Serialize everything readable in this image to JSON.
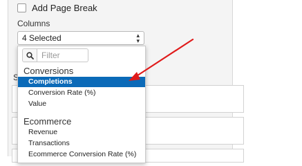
{
  "add_page_break": {
    "label": "Add Page Break",
    "checked": false
  },
  "columns": {
    "label": "Columns",
    "selected_text": "4 Selected",
    "filter_placeholder": "Filter",
    "groups": [
      {
        "title": "Conversions",
        "options": [
          {
            "label": "Completions",
            "highlighted": true
          },
          {
            "label": "Conversion Rate (%)",
            "highlighted": false
          },
          {
            "label": "Value",
            "highlighted": false
          }
        ]
      },
      {
        "title": "Ecommerce",
        "options": [
          {
            "label": "Revenue",
            "highlighted": false
          },
          {
            "label": "Transactions",
            "highlighted": false
          },
          {
            "label": "Ecommerce Conversion Rate (%)",
            "highlighted": false
          }
        ]
      }
    ]
  },
  "partial_label": "S",
  "colors": {
    "selected_bg": "#0b6ab8",
    "arrow": "#e01b1b",
    "panel_bg": "#f4f4f4"
  },
  "icons": {
    "search": "search-icon",
    "select_caret": "chevron-updown-icon",
    "annotation": "red-arrow"
  }
}
